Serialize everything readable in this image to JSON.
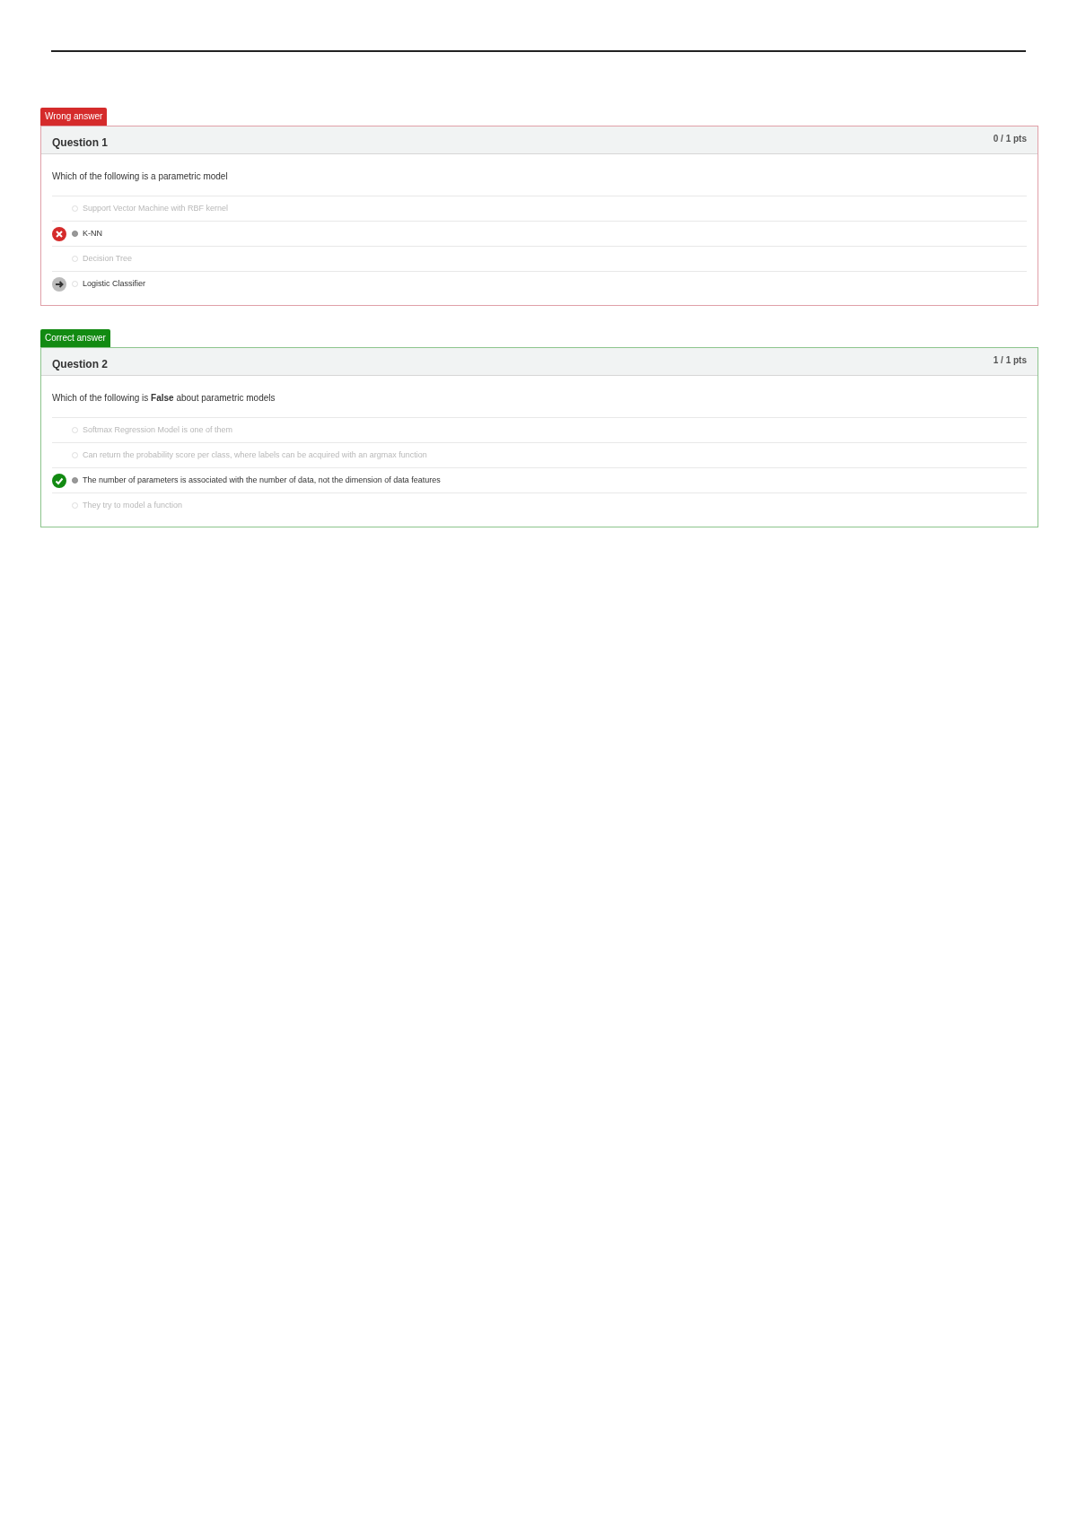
{
  "questions": [
    {
      "badge": "Wrong answer",
      "kind": "wrong",
      "title": "Question 1",
      "score": "0 / 1 pts",
      "prompt": "Which of the following is a parametric model",
      "answers": [
        {
          "text": "Support Vector Machine with RBF kernel",
          "selected": false,
          "kind": "plain"
        },
        {
          "text": "K-NN",
          "selected": true,
          "kind": "incorrect"
        },
        {
          "text": "Decision Tree",
          "selected": false,
          "kind": "plain"
        },
        {
          "text": "Logistic Classifier",
          "selected": false,
          "kind": "missed"
        }
      ]
    },
    {
      "badge": "Correct answer",
      "kind": "correct",
      "title": "Question 2",
      "score": "1 / 1 pts",
      "prompt": "Which of the following is **False** about parametric models",
      "answers": [
        {
          "text": "Softmax Regression Model is one of them",
          "selected": false,
          "kind": "plain"
        },
        {
          "text": "Can return the probability score per class, where labels can be acquired with an argmax function",
          "selected": false,
          "kind": "plain"
        },
        {
          "text": "The number of parameters is associated with the number of data, not the dimension of data features",
          "selected": true,
          "kind": "correct"
        },
        {
          "text": "They try to model a function",
          "selected": false,
          "kind": "plain"
        }
      ]
    }
  ]
}
